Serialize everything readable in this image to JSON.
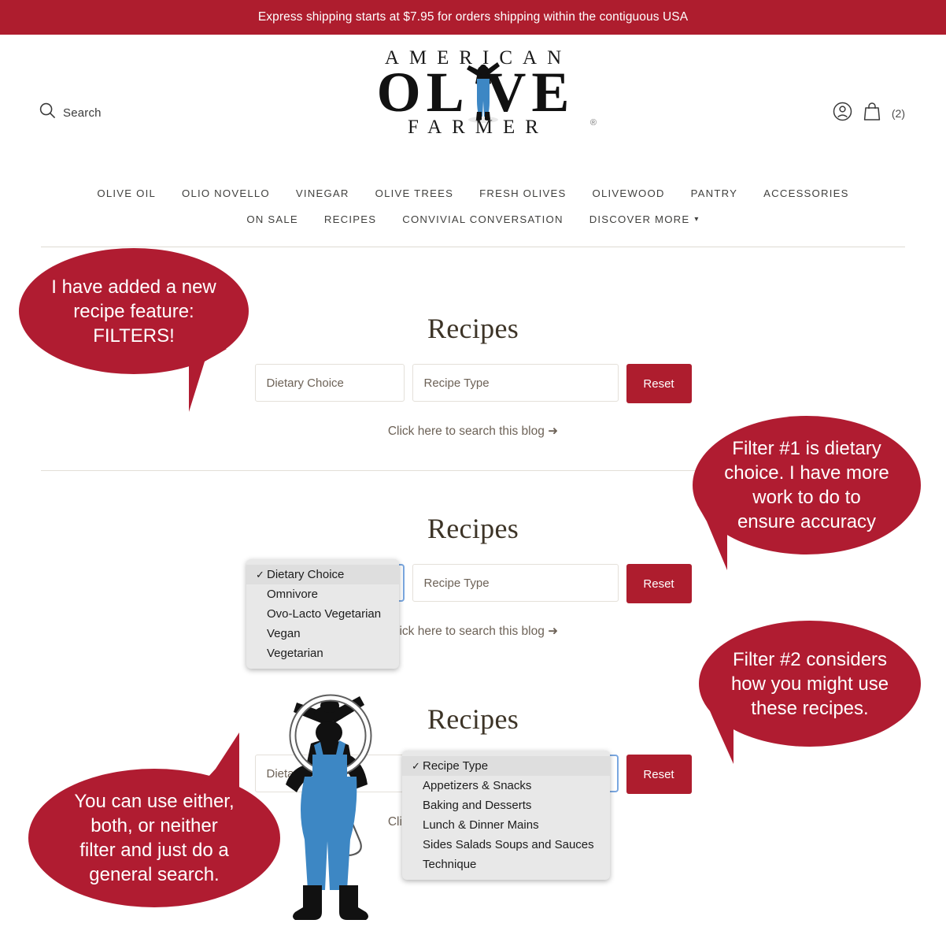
{
  "announcement": {
    "text": "Express shipping starts at $7.95 for orders shipping within the contiguous USA",
    "background": "#ae1d2e"
  },
  "header": {
    "search_label": "Search",
    "search_icon": "search-icon",
    "account_icon": "account-icon",
    "cart_icon": "shopping-bag-icon",
    "cart_count": "(2)",
    "logo": {
      "line1": "AMERICAN",
      "line2": "OL VE",
      "line3": "FARMER",
      "registered": "®"
    }
  },
  "nav": {
    "row1": [
      {
        "label": "OLIVE OIL"
      },
      {
        "label": "OLIO NOVELLO"
      },
      {
        "label": "VINEGAR"
      },
      {
        "label": "OLIVE TREES"
      },
      {
        "label": "FRESH OLIVES"
      },
      {
        "label": "OLIVEWOOD"
      },
      {
        "label": "PANTRY"
      },
      {
        "label": "ACCESSORIES"
      }
    ],
    "row2": [
      {
        "label": "ON SALE"
      },
      {
        "label": "RECIPES"
      },
      {
        "label": "CONVIVIAL CONVERSATION"
      },
      {
        "label": "DISCOVER MORE",
        "caret": "⌄"
      }
    ]
  },
  "sections": [
    {
      "title": "Recipes",
      "dietary_value": "Dietary Choice",
      "recipe_type_value": "Recipe Type",
      "reset_label": "Reset",
      "blog_link": "Click here to search this blog ➜"
    },
    {
      "title": "Recipes",
      "dietary_value": "Dietary Choice",
      "recipe_type_value": "Recipe Type",
      "reset_label": "Reset",
      "blog_link": "Click here to search this blog ➜"
    },
    {
      "title": "Recipes",
      "dietary_value": "Dietary Choice",
      "recipe_type_value": "Recipe Type",
      "reset_label": "Reset",
      "blog_link": "Click here to search this blog ➜"
    }
  ],
  "dropdowns": {
    "dietary": {
      "name": "dietary-choice-dropdown",
      "options": [
        {
          "label": "Dietary Choice",
          "selected": true
        },
        {
          "label": "Omnivore",
          "selected": false
        },
        {
          "label": "Ovo-Lacto Vegetarian",
          "selected": false
        },
        {
          "label": "Vegan",
          "selected": false
        },
        {
          "label": "Vegetarian",
          "selected": false
        }
      ]
    },
    "recipe_type": {
      "name": "recipe-type-dropdown",
      "options": [
        {
          "label": "Recipe Type",
          "selected": true
        },
        {
          "label": "Appetizers & Snacks",
          "selected": false
        },
        {
          "label": "Baking and Desserts",
          "selected": false
        },
        {
          "label": "Lunch & Dinner Mains",
          "selected": false
        },
        {
          "label": "Sides Salads Soups and Sauces",
          "selected": false
        },
        {
          "label": "Technique",
          "selected": false
        }
      ]
    }
  },
  "annotations": [
    {
      "id": "bubble-1",
      "text": "I have added a new\nrecipe feature:\nFILTERS!"
    },
    {
      "id": "bubble-2",
      "text": "Filter #1 is dietary\nchoice. I have more\nwork to do to\nensure accuracy"
    },
    {
      "id": "bubble-3",
      "text": "Filter #2 considers\nhow you might use\nthese recipes."
    },
    {
      "id": "bubble-4",
      "text": "You can use either,\nboth, or neither\nfilter and just do a\ngeneral search."
    }
  ],
  "colors": {
    "brand_crimson": "#ae1d2e",
    "bubble_crimson": "#b01c31",
    "overalls_blue": "#3d87c4",
    "title_brown": "#3d3427",
    "text_gray": "#6d6257"
  }
}
